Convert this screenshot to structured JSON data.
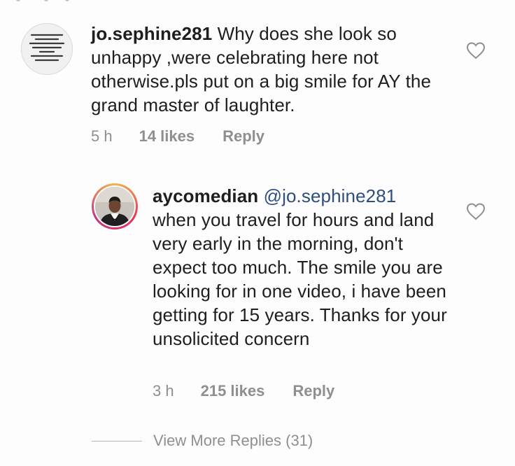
{
  "comments": [
    {
      "username": "jo.sephine281",
      "text": " Why does she look so unhappy ,were celebrating here not otherwise.pls put on a big smile for AY the grand master of laughter.",
      "time": "5 h",
      "likes": "14 likes",
      "reply_label": "Reply",
      "avatar_icon": "text-image-avatar-icon"
    }
  ],
  "replies": [
    {
      "username": "aycomedian",
      "mention": "@jo.sephine281",
      "text": "when you travel for hours and land very early in the morning, don't expect too much. The smile you are looking for in one video, i have been getting for 15 years. Thanks for your unsolicited concern",
      "time": "3 h",
      "likes": "215 likes",
      "reply_label": "Reply",
      "avatar_icon": "profile-photo-avatar-icon"
    }
  ],
  "view_more_replies": "View More Replies (31)",
  "like_icon": "heart-outline-icon",
  "colors": {
    "background": "#fdfdfd",
    "text": "#1e1e1e",
    "meta": "#8f8f8f",
    "mention": "#2f4e80",
    "story_ring": [
      "#f6b44a",
      "#e8345a",
      "#c13584"
    ]
  }
}
